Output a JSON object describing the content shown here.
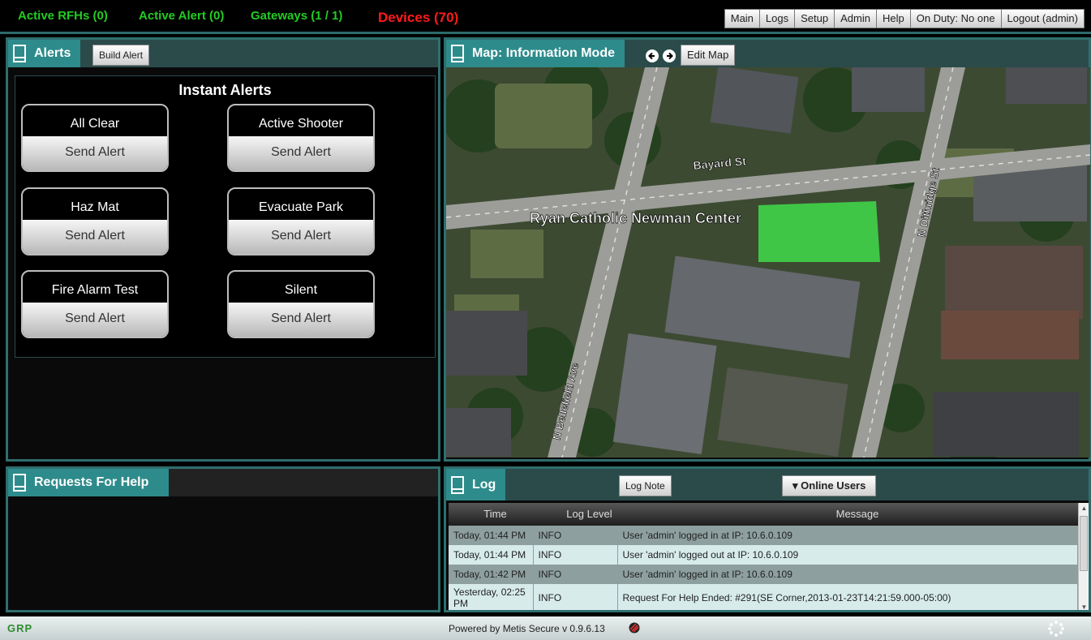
{
  "topbar": {
    "active_rfhs": "Active RFHs (0)",
    "active_alert": "Active Alert (0)",
    "gateways": "Gateways (1 / 1)",
    "devices": "Devices (70)",
    "nav": [
      "Main",
      "Logs",
      "Setup",
      "Admin",
      "Help",
      "On Duty: No one",
      "Logout (admin)"
    ]
  },
  "alerts_panel": {
    "title": "Alerts",
    "build_button": "Build Alert",
    "instant_title": "Instant Alerts",
    "cards": [
      {
        "name": "All Clear",
        "action": "Send Alert"
      },
      {
        "name": "Active Shooter",
        "action": "Send Alert"
      },
      {
        "name": "Haz Mat",
        "action": "Send Alert"
      },
      {
        "name": "Evacuate Park",
        "action": "Send Alert"
      },
      {
        "name": "Fire Alarm Test",
        "action": "Send Alert"
      },
      {
        "name": "Silent",
        "action": "Send Alert"
      }
    ]
  },
  "map_panel": {
    "title": "Map: Information Mode",
    "edit_button": "Edit Map",
    "labels": {
      "street1": "Bayard St",
      "street2": "N Dithridge St",
      "street3": "N Bellefield Ave",
      "building": "Ryan Catholic Newman Center"
    }
  },
  "rfh_panel": {
    "title": "Requests For Help"
  },
  "log_panel": {
    "title": "Log",
    "note_button": "Log Note",
    "users_button": "▾ Online Users",
    "columns": [
      "Time",
      "Log Level",
      "Message"
    ],
    "rows": [
      {
        "time": "Today, 01:44 PM",
        "level": "INFO",
        "message": "User 'admin' logged in at IP: 10.6.0.109"
      },
      {
        "time": "Today, 01:44 PM",
        "level": "INFO",
        "message": "User 'admin' logged out at IP: 10.6.0.109"
      },
      {
        "time": "Today, 01:42 PM",
        "level": "INFO",
        "message": "User 'admin' logged in at IP: 10.6.0.109"
      },
      {
        "time": "Yesterday, 02:25 PM",
        "level": "INFO",
        "message": "Request For Help Ended: #291(SE Corner,2013-01-23T14:21:59.000-05:00)"
      }
    ]
  },
  "footer": {
    "brand": "GRP",
    "powered": "Powered by Metis Secure v 0.9.6.13"
  },
  "colors": {
    "status_green": "#22cc22",
    "devices_red": "#ff1a1a",
    "accent_teal": "#2e8b8b"
  },
  "icons": [
    "panel-icon",
    "arrow-left-icon",
    "arrow-right-icon",
    "scroll-up-icon",
    "scroll-down-icon",
    "metis-logo-icon",
    "spinner-icon"
  ]
}
